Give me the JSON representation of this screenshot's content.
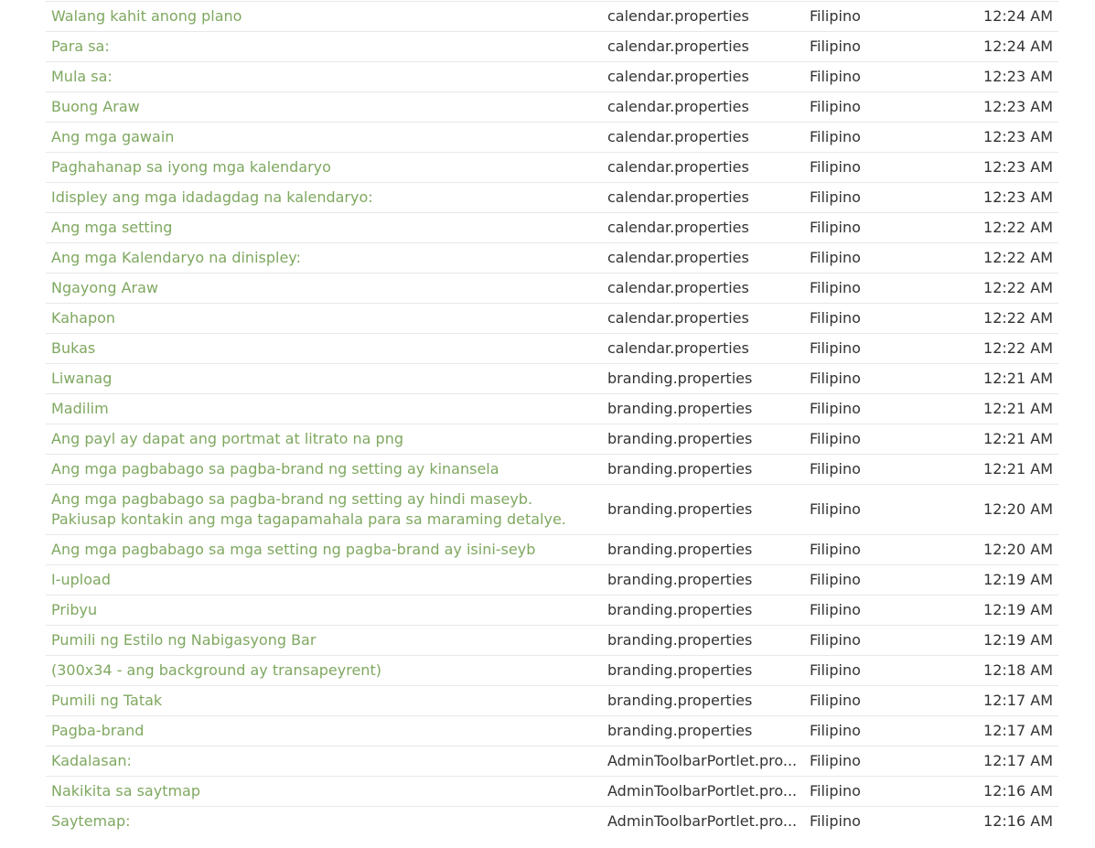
{
  "rows": [
    {
      "text": "Walang kahit anong plano",
      "file": "calendar.properties",
      "language": "Filipino",
      "time": "12:24 AM"
    },
    {
      "text": "Para sa:",
      "file": "calendar.properties",
      "language": "Filipino",
      "time": "12:24 AM"
    },
    {
      "text": "Mula sa:",
      "file": "calendar.properties",
      "language": "Filipino",
      "time": "12:23 AM"
    },
    {
      "text": "Buong Araw",
      "file": "calendar.properties",
      "language": "Filipino",
      "time": "12:23 AM"
    },
    {
      "text": "Ang mga gawain",
      "file": "calendar.properties",
      "language": "Filipino",
      "time": "12:23 AM"
    },
    {
      "text": "Paghahanap sa iyong mga kalendaryo",
      "file": "calendar.properties",
      "language": "Filipino",
      "time": "12:23 AM"
    },
    {
      "text": "Idispley ang mga idadagdag na kalendaryo:",
      "file": "calendar.properties",
      "language": "Filipino",
      "time": "12:23 AM"
    },
    {
      "text": "Ang mga setting",
      "file": "calendar.properties",
      "language": "Filipino",
      "time": "12:22 AM"
    },
    {
      "text": "Ang mga Kalendaryo na dinispley:",
      "file": "calendar.properties",
      "language": "Filipino",
      "time": "12:22 AM"
    },
    {
      "text": "Ngayong Araw",
      "file": "calendar.properties",
      "language": "Filipino",
      "time": "12:22 AM"
    },
    {
      "text": "Kahapon",
      "file": "calendar.properties",
      "language": "Filipino",
      "time": "12:22 AM"
    },
    {
      "text": "Bukas",
      "file": "calendar.properties",
      "language": "Filipino",
      "time": "12:22 AM"
    },
    {
      "text": "Liwanag",
      "file": "branding.properties",
      "language": "Filipino",
      "time": "12:21 AM"
    },
    {
      "text": "Madilim",
      "file": "branding.properties",
      "language": "Filipino",
      "time": "12:21 AM"
    },
    {
      "text": "Ang payl ay dapat ang portmat at litrato na png",
      "file": "branding.properties",
      "language": "Filipino",
      "time": "12:21 AM"
    },
    {
      "text": "Ang mga pagbabago sa pagba-brand ng setting ay kinansela",
      "file": "branding.properties",
      "language": "Filipino",
      "time": "12:21 AM"
    },
    {
      "text": "Ang mga pagbabago sa pagba-brand ng setting ay hindi maseyb. Pakiusap kontakin ang mga tagapamahala para sa maraming detalye.",
      "file": "branding.properties",
      "language": "Filipino",
      "time": "12:20 AM"
    },
    {
      "text": "Ang mga pagbabago sa mga setting ng pagba-brand ay isini-seyb",
      "file": "branding.properties",
      "language": "Filipino",
      "time": "12:20 AM"
    },
    {
      "text": "I-upload",
      "file": "branding.properties",
      "language": "Filipino",
      "time": "12:19 AM"
    },
    {
      "text": "Pribyu",
      "file": "branding.properties",
      "language": "Filipino",
      "time": "12:19 AM"
    },
    {
      "text": "Pumili ng Estilo ng Nabigasyong Bar",
      "file": "branding.properties",
      "language": "Filipino",
      "time": "12:19 AM"
    },
    {
      "text": "(300x34 - ang background ay transapeyrent)",
      "file": "branding.properties",
      "language": "Filipino",
      "time": "12:18 AM"
    },
    {
      "text": "Pumili ng Tatak",
      "file": "branding.properties",
      "language": "Filipino",
      "time": "12:17 AM"
    },
    {
      "text": "Pagba-brand",
      "file": "branding.properties",
      "language": "Filipino",
      "time": "12:17 AM"
    },
    {
      "text": "Kadalasan:",
      "file": "AdminToolbarPortlet.pro...",
      "language": "Filipino",
      "time": "12:17 AM"
    },
    {
      "text": "Nakikita sa saytmap",
      "file": "AdminToolbarPortlet.pro...",
      "language": "Filipino",
      "time": "12:16 AM"
    },
    {
      "text": "Saytemap:",
      "file": "AdminToolbarPortlet.pro...",
      "language": "Filipino",
      "time": "12:16 AM"
    }
  ],
  "colors": {
    "link": "#7fa860",
    "text": "#333333",
    "divider": "#e8e8e8"
  }
}
